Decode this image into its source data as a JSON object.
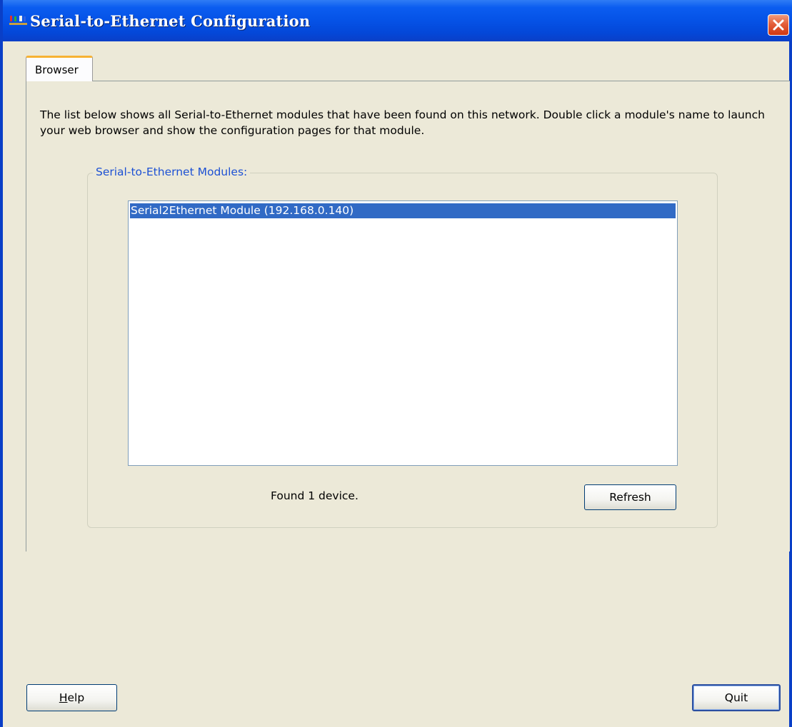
{
  "window": {
    "title": "Serial-to-Ethernet Configuration",
    "close_icon": "close-icon"
  },
  "tabs": [
    {
      "label": "Browser",
      "active": true
    }
  ],
  "browser": {
    "description": "The list below shows all Serial-to-Ethernet modules that have been found on this network. Double click a module's name to launch your web browser and show the configuration pages for that module.",
    "group_label": "Serial-to-Ethernet Modules:",
    "modules": [
      {
        "label": "Serial2Ethernet Module (192.168.0.140)",
        "selected": true
      }
    ],
    "status": "Found 1 device.",
    "refresh_label": "Refresh"
  },
  "footer": {
    "help_mnemonic": "H",
    "help_rest": "elp",
    "quit_label": "Quit"
  },
  "colors": {
    "titlebar": "#0552e6",
    "window_bg": "#ece9d8",
    "selection": "#316ac5",
    "group_label": "#1d51d4",
    "tab_highlight": "#f7b233",
    "close_button": "#e45f3b"
  }
}
